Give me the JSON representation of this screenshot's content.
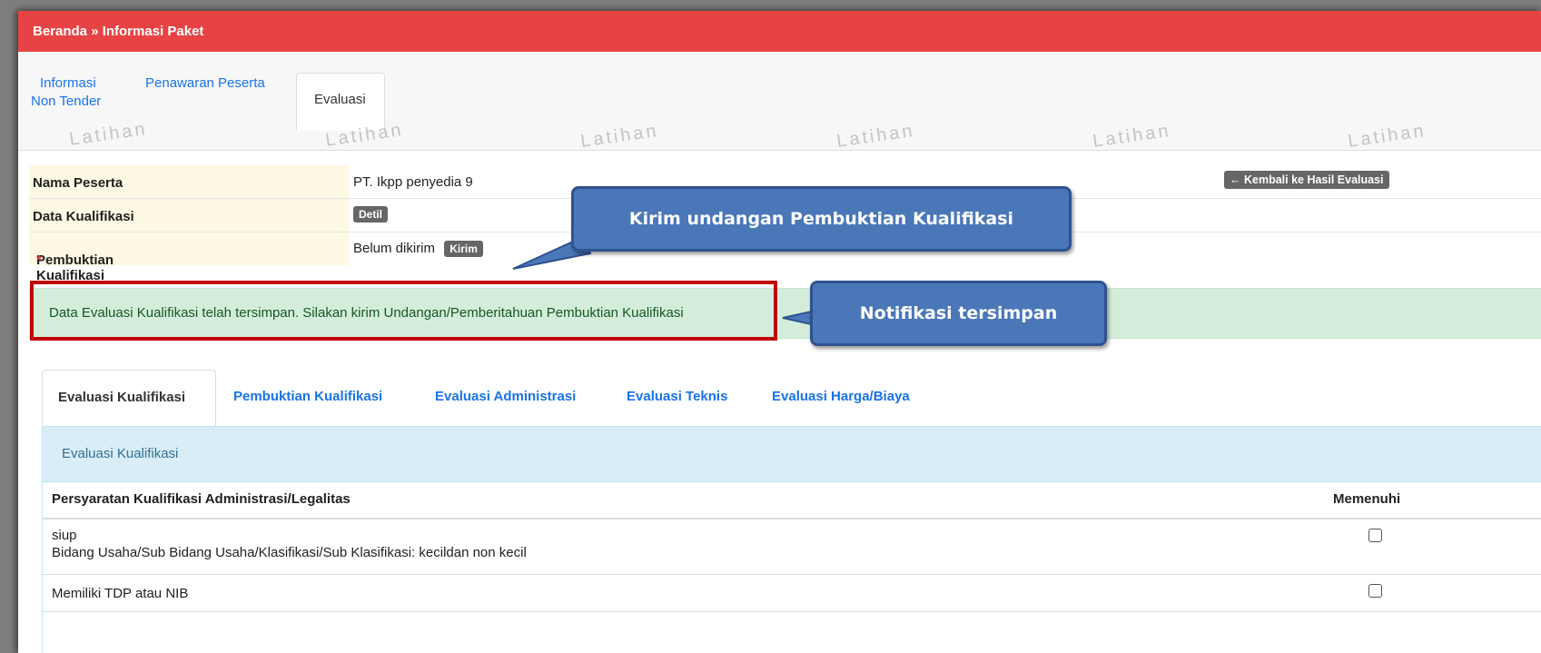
{
  "breadcrumb": "Beranda » Informasi Paket",
  "top_tabs": [
    {
      "line1": "Informasi",
      "line2": "Non Tender"
    },
    {
      "label": "Penawaran Peserta"
    },
    {
      "label": "Evaluasi"
    }
  ],
  "watermark": "Latihan",
  "info": {
    "nama_label": "Nama Peserta",
    "nama_value": "PT. Ikpp penyedia 9",
    "kualifikasi_label": "Data Kualifikasi",
    "detil_button": "Detil",
    "pembuktian_label": "Pembuktian Kualifikasi",
    "required_mark": "*",
    "pembuktian_status": "Belum dikirim",
    "kirim_button": "Kirim",
    "kembali_button": "← Kembali ke Hasil Evaluasi"
  },
  "alert_text": "Data Evaluasi Kualifikasi telah tersimpan. Silakan kirim Undangan/Pemberitahuan Pembuktian Kualifikasi",
  "callouts": {
    "kirim": "Kirim undangan Pembuktian Kualifikasi",
    "notifikasi": "Notifikasi tersimpan"
  },
  "sub_tabs": [
    "Evaluasi Kualifikasi",
    "Pembuktian Kualifikasi",
    "Evaluasi Administrasi",
    "Evaluasi Teknis",
    "Evaluasi Harga/Biaya"
  ],
  "panel": {
    "title": "Evaluasi Kualifikasi",
    "col_requirement": "Persyaratan Kualifikasi Administrasi/Legalitas",
    "col_memenuhi": "Memenuhi",
    "rows": [
      {
        "line1": "siup",
        "line2": "Bidang Usaha/Sub Bidang Usaha/Klasifikasi/Sub Klasifikasi: kecildan non kecil",
        "checked": false
      },
      {
        "line1": "Memiliki TDP atau NIB",
        "checked": false
      }
    ]
  },
  "colors": {
    "header_red": "#e84344",
    "link_blue": "#1a73e8",
    "callout_blue": "#4a77b8",
    "highlight_red": "#c00000",
    "alert_green": "#d4eddb"
  }
}
